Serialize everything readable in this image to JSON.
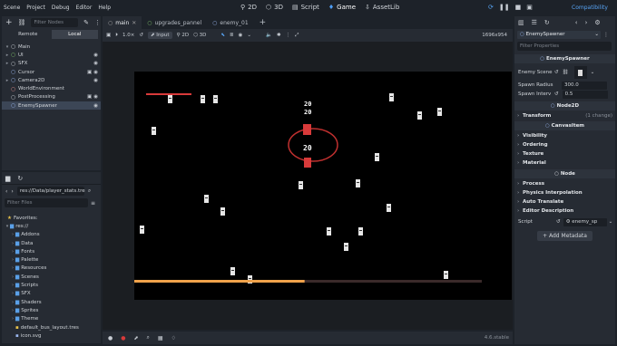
{
  "menu": [
    "Scene",
    "Project",
    "Debug",
    "Editor",
    "Help"
  ],
  "workspaces": [
    {
      "label": "2D",
      "icon": "2d-view-icon",
      "active": false
    },
    {
      "label": "3D",
      "icon": "3d-view-icon",
      "active": false
    },
    {
      "label": "Script",
      "icon": "script-icon",
      "active": false
    },
    {
      "label": "Game",
      "icon": "game-icon",
      "active": true
    },
    {
      "label": "AssetLib",
      "icon": "assetlib-icon",
      "active": false
    }
  ],
  "renderer": "Compatibility",
  "scene_dock": {
    "tabs": [
      "Scene",
      "Import"
    ],
    "filter_placeholder": "Filter Nodes",
    "remote_label": "Remote",
    "local_label": "Local",
    "nodes": [
      {
        "label": "Main",
        "icon": "node-icon",
        "depth": 0,
        "arrow": "▾"
      },
      {
        "label": "UI",
        "icon": "control-icon",
        "depth": 1,
        "arrow": "▸"
      },
      {
        "label": "SFX",
        "icon": "node-icon",
        "depth": 1,
        "arrow": "▸"
      },
      {
        "label": "Cursor",
        "icon": "node2d-icon",
        "depth": 1,
        "arrow": ""
      },
      {
        "label": "Camera2D",
        "icon": "camera-icon",
        "depth": 1,
        "arrow": "▸"
      },
      {
        "label": "WorldEnvironment",
        "icon": "world-environment-icon",
        "depth": 1,
        "arrow": ""
      },
      {
        "label": "PostProcessing",
        "icon": "canvas-layer-icon",
        "depth": 1,
        "arrow": ""
      },
      {
        "label": "EnemySpawner",
        "icon": "node2d-icon",
        "depth": 1,
        "arrow": "",
        "selected": true
      }
    ]
  },
  "filesystem": {
    "path": "res://Data/player_stats.tre",
    "filter_placeholder": "Filter Files",
    "favorites_label": "Favorites:",
    "root_label": "res://",
    "folders": [
      "Addons",
      "Data",
      "Fonts",
      "Palette",
      "Resources",
      "Scenes",
      "Scripts",
      "SFX",
      "Shaders",
      "Sprites",
      "Theme"
    ],
    "files": [
      "default_bus_layout.tres",
      "icon.svg"
    ]
  },
  "doc_tabs": [
    "main",
    "upgrades_pannel",
    "enemy_01"
  ],
  "viewport_toolbar": {
    "speed": "1.0×",
    "input": "Input",
    "mode_2d": "2D",
    "mode_3d": "3D",
    "resolution": "1696x954"
  },
  "game": {
    "top_score": "20\n20",
    "score_stack": [
      "20",
      "20"
    ],
    "player_value": "20",
    "health_fraction": 0.49
  },
  "version": "4.6.stable",
  "inspector": {
    "node_name": "EnemySpawner",
    "filter_placeholder": "Filter Properties",
    "class_title": "EnemySpawner",
    "props": [
      {
        "label": "Enemy Scene",
        "value": ""
      },
      {
        "label": "Spawn Radius",
        "value": "300.0"
      },
      {
        "label": "Spawn Interv",
        "value": "0.5"
      }
    ],
    "node2d_title": "Node2D",
    "transform_label": "Transform",
    "transform_note": "(1 change)",
    "canvasitem_title": "CanvasItem",
    "canvas_cats": [
      "Visibility",
      "Ordering",
      "Texture",
      "Material"
    ],
    "node_title": "Node",
    "node_cats": [
      "Process",
      "Physics Interpolation",
      "Auto Translate",
      "Editor Description"
    ],
    "script_label": "Script",
    "script_value": "enemy_sp",
    "add_metadata": "Add Metadata"
  },
  "colors": {
    "accent": "#4e9df5",
    "health_bar": "#f0a24b",
    "enemy_red": "#d83a3a",
    "ring": "#c0302f"
  }
}
